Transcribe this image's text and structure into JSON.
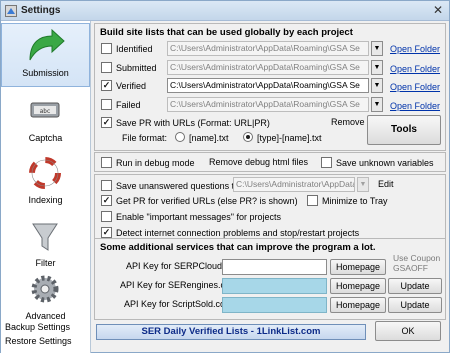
{
  "window": {
    "title": "Settings"
  },
  "sidebar": {
    "items": [
      {
        "label": "Submission",
        "icon": "green-arrow-icon",
        "active": true
      },
      {
        "label": "Captcha",
        "icon": "captcha-chip-icon"
      },
      {
        "label": "Indexing",
        "icon": "lifebuoy-icon"
      },
      {
        "label": "Filter",
        "icon": "funnel-icon"
      },
      {
        "label": "Advanced",
        "icon": "gear-icon"
      }
    ],
    "links": [
      "Backup Settings",
      "Restore Settings"
    ]
  },
  "site_lists": {
    "header": "Build site lists that can be used globally by each project",
    "rows": [
      {
        "label": "Identified",
        "checked": false,
        "path": "C:\\Users\\Administrator\\AppData\\Roaming\\GSA Se",
        "enabled": false,
        "open": "Open Folder"
      },
      {
        "label": "Submitted",
        "checked": false,
        "path": "C:\\Users\\Administrator\\AppData\\Roaming\\GSA Se",
        "enabled": false,
        "open": "Open Folder"
      },
      {
        "label": "Verified",
        "checked": true,
        "path": "C:\\Users\\Administrator\\AppData\\Roaming\\GSA Se",
        "enabled": true,
        "open": "Open Folder"
      },
      {
        "label": "Failed",
        "checked": false,
        "path": "C:\\Users\\Administrator\\AppData\\Roaming\\GSA Se",
        "enabled": false,
        "open": "Open Folder"
      }
    ],
    "save_pr": {
      "label": "Save PR with URLs (Format: URL|PR)",
      "checked": true
    },
    "remove": "Remove",
    "file_format": {
      "label": "File format:",
      "option1": "[name].txt",
      "option2": "[type]-[name].txt",
      "selected": 2
    },
    "tools": "Tools"
  },
  "debug": {
    "run_debug": "Run in debug mode",
    "remove_debug": "Remove debug html files",
    "save_unknown": "Save unknown variables"
  },
  "options": {
    "save_unanswered": {
      "label": "Save unanswered questions to file",
      "checked": false,
      "path": "C:\\Users\\Administrator\\AppData\\",
      "edit": "Edit"
    },
    "get_pr": {
      "label": "Get PR for verified URLs (else PR? is shown)",
      "checked": true
    },
    "minimize": {
      "label": "Minimize to Tray",
      "checked": false
    },
    "important": {
      "label": "Enable \"important messages\" for projects",
      "checked": false
    },
    "detect": {
      "label": "Detect internet connection problems and stop/restart projects",
      "checked": true
    }
  },
  "services": {
    "header": "Some additional services that can improve the program a lot.",
    "coupon": "Use Coupon GSAOFF",
    "rows": [
      {
        "label": "API Key for SERPCloud.com",
        "button1": "Homepage",
        "button2": ""
      },
      {
        "label": "API Key for SERengines.com",
        "button1": "Homepage",
        "button2": "Update"
      },
      {
        "label": "API Key for ScriptSold.com",
        "button1": "Homepage",
        "button2": "Update"
      }
    ]
  },
  "footer": {
    "banner": "SER Daily Verified Lists - 1LinkList.com",
    "ok": "OK"
  }
}
